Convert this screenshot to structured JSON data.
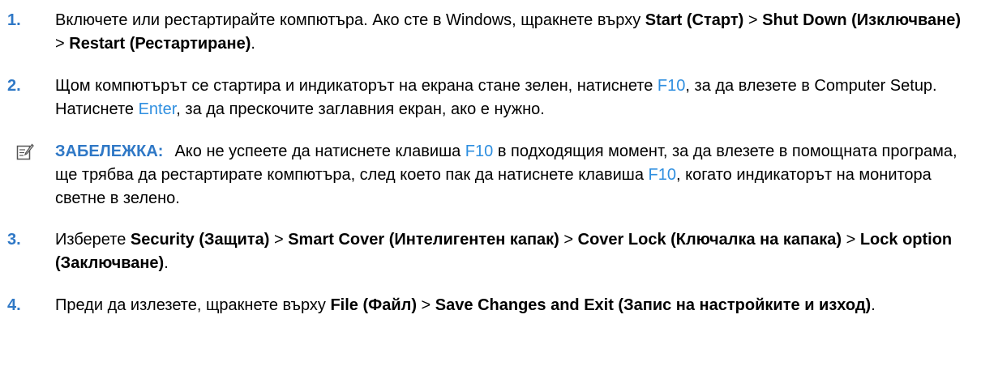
{
  "steps": [
    {
      "num": "1.",
      "parts": [
        {
          "t": "Включете или рестартирайте компютъра. Ако сте в Windows, щракнете върху "
        },
        {
          "t": "Start (Старт)",
          "b": true
        },
        {
          "t": " > "
        },
        {
          "t": "Shut Down (Изключване)",
          "b": true
        },
        {
          "t": " > "
        },
        {
          "t": "Restart (Рестартиране)",
          "b": true
        },
        {
          "t": "."
        }
      ]
    },
    {
      "num": "2.",
      "parts": [
        {
          "t": "Щом компютърът се стартира и индикаторът на екрана стане зелен, натиснете "
        },
        {
          "t": "F10",
          "k": true
        },
        {
          "t": ", за да влезете в Computer Setup. Натиснете "
        },
        {
          "t": "Enter",
          "k": true
        },
        {
          "t": ", за да прескочите заглавния екран, ако е нужно."
        }
      ]
    },
    {
      "num": "3.",
      "parts": [
        {
          "t": "Изберете "
        },
        {
          "t": "Security (Защита)",
          "b": true
        },
        {
          "t": " > "
        },
        {
          "t": "Smart Cover (Интелигентен капак)",
          "b": true
        },
        {
          "t": " > "
        },
        {
          "t": "Cover Lock (Ключалка на капака)",
          "b": true
        },
        {
          "t": " > "
        },
        {
          "t": "Lock option (Заключване)",
          "b": true
        },
        {
          "t": "."
        }
      ]
    },
    {
      "num": "4.",
      "parts": [
        {
          "t": "Преди да излезете, щракнете върху "
        },
        {
          "t": "File (Файл)",
          "b": true
        },
        {
          "t": " > "
        },
        {
          "t": "Save Changes and Exit (Запис на настройките и изход)",
          "b": true
        },
        {
          "t": "."
        }
      ]
    }
  ],
  "note": {
    "icon": "note-pencil-icon",
    "label": "ЗАБЕЛЕЖКА:",
    "parts": [
      {
        "t": "Ако не успеете да натиснете клавиша "
      },
      {
        "t": "F10",
        "k": true
      },
      {
        "t": " в подходящия момент, за да влезете в помощната програма, ще трябва да рестартирате компютъра, след което пак да натиснете клавиша "
      },
      {
        "t": "F10",
        "k": true
      },
      {
        "t": ", когато индикаторът на монитора светне в зелено."
      }
    ]
  },
  "colors": {
    "number": "#2f78c6",
    "key": "#2f8fe0",
    "text": "#000000"
  }
}
